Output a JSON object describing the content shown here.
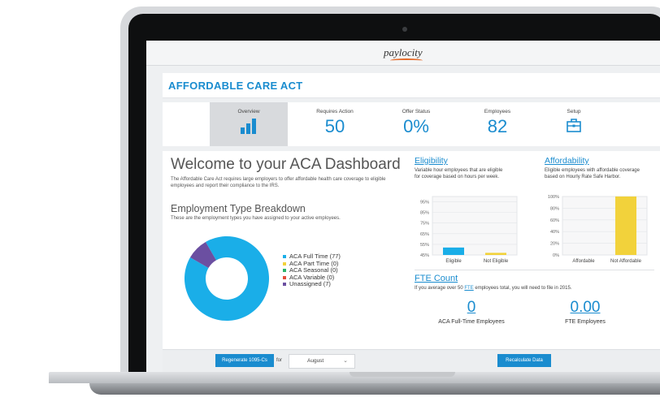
{
  "app": {
    "logo": "paylocity",
    "title": "AFFORDABLE CARE ACT"
  },
  "colors": {
    "accent": "#1a8ccf",
    "full_time": "#1aaee8",
    "part_time": "#f2d23b",
    "seasonal": "#2bb36b",
    "variable": "#e44d3a",
    "unassigned": "#6b4fa1"
  },
  "tabs": [
    {
      "label": "Overview",
      "icon": "bar-chart-icon"
    },
    {
      "label": "Requires Action",
      "value": "50"
    },
    {
      "label": "Offer Status",
      "value": "0%"
    },
    {
      "label": "Employees",
      "value": "82"
    },
    {
      "label": "Setup",
      "icon": "toolbox-icon"
    }
  ],
  "welcome": {
    "title": "Welcome to your ACA Dashboard",
    "text": "The Affordable Care Act requires large employers to offer affordable health care coverage to eligible employees and report their compliance to the IRS."
  },
  "breakdown": {
    "title": "Employment Type Breakdown",
    "subtitle": "These are the employment types you have assigned to your active employees.",
    "legend": [
      {
        "label": "ACA Full Time (77)",
        "color": "#1aaee8"
      },
      {
        "label": "ACA Part Time (0)",
        "color": "#f2d23b"
      },
      {
        "label": "ACA Seasonal (0)",
        "color": "#2bb36b"
      },
      {
        "label": "ACA Variable (0)",
        "color": "#e44d3a"
      },
      {
        "label": "Unassigned (7)",
        "color": "#6b4fa1"
      }
    ]
  },
  "eligibility": {
    "title": "Eligibility",
    "subtitle_line1": "Variable hour employees that are eligible",
    "subtitle_line2": "for coverage based on hours per week."
  },
  "affordability": {
    "title": "Affordability",
    "subtitle_line1": "Eligible employees with affordable coverage",
    "subtitle_line2": "based on Hourly Rate Safe Harbor."
  },
  "fte": {
    "title": "FTE Count",
    "sub_before": "If you average over 50 ",
    "sub_link": "FTE",
    "sub_after": " employees total, you will need to file in 2015.",
    "full_time_value": "0",
    "full_time_label": "ACA Full-Time Employees",
    "fte_value": "0.00",
    "fte_label": "FTE Employees"
  },
  "footer": {
    "regenerate_label": "Regenerate 1095-Cs",
    "for_label": "for",
    "month_selected": "August",
    "recalc_label": "Recalculate Data"
  },
  "chart_data": [
    {
      "type": "pie",
      "title": "Employment Type Breakdown",
      "categories": [
        "ACA Full Time",
        "ACA Part Time",
        "ACA Seasonal",
        "ACA Variable",
        "Unassigned"
      ],
      "values": [
        77,
        0,
        0,
        0,
        7
      ],
      "donut": true
    },
    {
      "type": "bar",
      "title": "Eligibility",
      "categories": [
        "Eligible",
        "Not Eligible"
      ],
      "values": [
        52,
        47
      ],
      "colors": [
        "#1aaee8",
        "#f2d23b"
      ],
      "ylim": [
        45,
        100
      ],
      "yticks": [
        "95%",
        "85%",
        "75%",
        "65%",
        "55%",
        "45%"
      ],
      "ytick_values": [
        95,
        85,
        75,
        65,
        55,
        45
      ],
      "grid": true
    },
    {
      "type": "bar",
      "title": "Affordability",
      "categories": [
        "Affordable",
        "Not Affordable"
      ],
      "values": [
        0,
        100
      ],
      "colors": [
        "#1aaee8",
        "#f2d23b"
      ],
      "ylim": [
        0,
        100
      ],
      "yticks": [
        "100%",
        "80%",
        "60%",
        "40%",
        "20%",
        "0%"
      ],
      "ytick_values": [
        100,
        80,
        60,
        40,
        20,
        0
      ],
      "grid": true
    }
  ]
}
